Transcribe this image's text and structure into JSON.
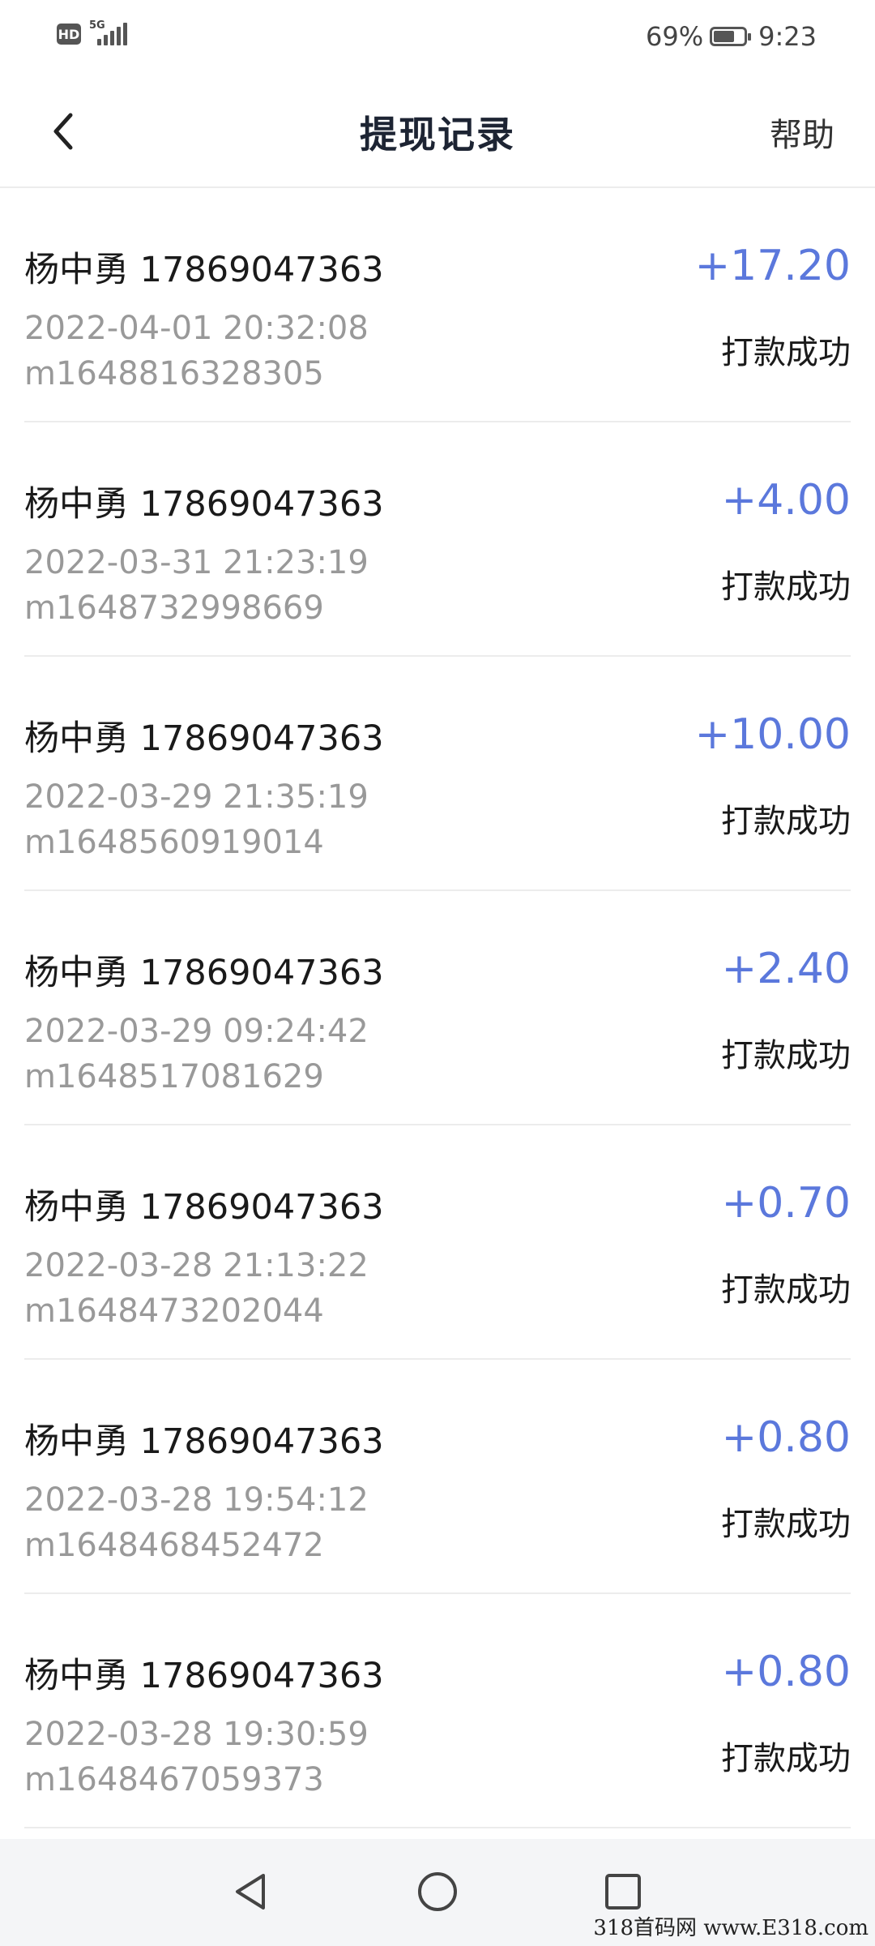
{
  "status_bar": {
    "hd_label": "HD",
    "network_label": "5G",
    "battery_percent": "69%",
    "battery_level": 0.69,
    "time": "9:23"
  },
  "header": {
    "title": "提现记录",
    "help_label": "帮助",
    "back_icon": "chevron-left-icon"
  },
  "records": [
    {
      "name": "杨中勇 17869047363",
      "time": "2022-04-01 20:32:08",
      "order_id": "m1648816328305",
      "amount": "+17.20",
      "status": "打款成功"
    },
    {
      "name": "杨中勇 17869047363",
      "time": "2022-03-31 21:23:19",
      "order_id": "m1648732998669",
      "amount": "+4.00",
      "status": "打款成功"
    },
    {
      "name": "杨中勇 17869047363",
      "time": "2022-03-29 21:35:19",
      "order_id": "m1648560919014",
      "amount": "+10.00",
      "status": "打款成功"
    },
    {
      "name": "杨中勇 17869047363",
      "time": "2022-03-29 09:24:42",
      "order_id": "m1648517081629",
      "amount": "+2.40",
      "status": "打款成功"
    },
    {
      "name": "杨中勇 17869047363",
      "time": "2022-03-28 21:13:22",
      "order_id": "m1648473202044",
      "amount": "+0.70",
      "status": "打款成功"
    },
    {
      "name": "杨中勇 17869047363",
      "time": "2022-03-28 19:54:12",
      "order_id": "m1648468452472",
      "amount": "+0.80",
      "status": "打款成功"
    },
    {
      "name": "杨中勇 17869047363",
      "time": "2022-03-28 19:30:59",
      "order_id": "m1648467059373",
      "amount": "+0.80",
      "status": "打款成功"
    }
  ],
  "colors": {
    "amount": "#5b78dc",
    "secondary_text": "#999999",
    "divider": "#ececec"
  },
  "nav_bar": {
    "icons": [
      "back-triangle-icon",
      "home-circle-icon",
      "recents-square-icon"
    ]
  },
  "watermark": "318首码网 www.E318.com"
}
